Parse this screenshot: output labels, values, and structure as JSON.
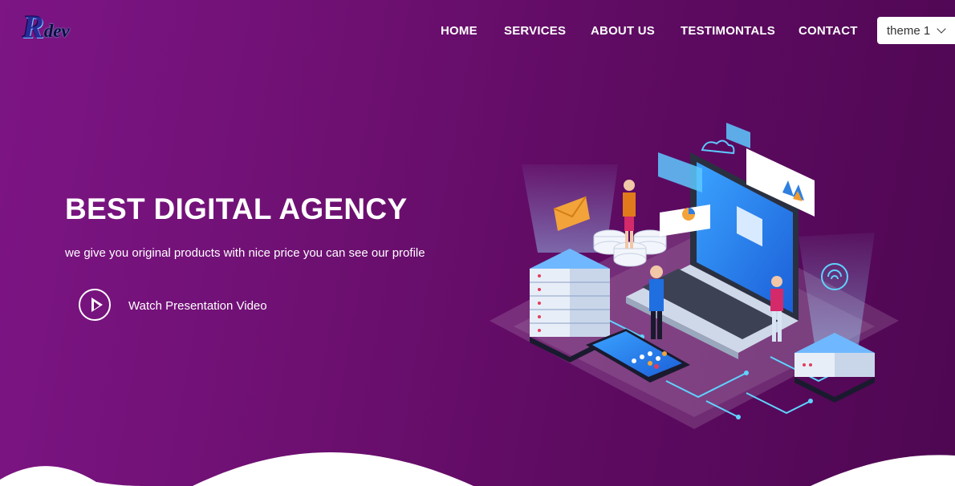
{
  "logo": {
    "big": "R",
    "small": "dev"
  },
  "nav": {
    "items": [
      "HOME",
      "SERVICES",
      "ABOUT US",
      "TESTIMONTALS",
      "CONTACT"
    ]
  },
  "theme_select": {
    "value": "theme 1"
  },
  "hero": {
    "title": "BEST DIGITAL AGENCY",
    "subtitle": "we give you original products with nice price you can see our profile",
    "video_label": "Watch Presentation Video"
  },
  "icons": {
    "play": "play-icon",
    "chevron": "chevron-down-icon"
  }
}
